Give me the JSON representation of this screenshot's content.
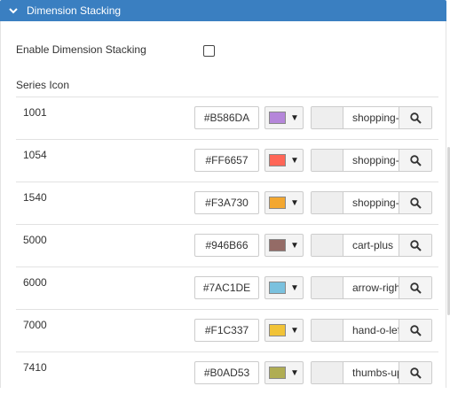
{
  "section": {
    "title": "Dimension Stacking"
  },
  "enable_label": "Enable Dimension Stacking",
  "series_icon_label": "Series Icon",
  "series": [
    {
      "name": "1001",
      "color": "#B586DA",
      "icon": "shopping-cart"
    },
    {
      "name": "1054",
      "color": "#FF6657",
      "icon": "shopping-cart"
    },
    {
      "name": "1540",
      "color": "#F3A730",
      "icon": "shopping-cart"
    },
    {
      "name": "5000",
      "color": "#946B66",
      "icon": "cart-plus"
    },
    {
      "name": "6000",
      "color": "#7AC1DE",
      "icon": "arrow-right"
    },
    {
      "name": "7000",
      "color": "#F1C337",
      "icon": "hand-o-left"
    },
    {
      "name": "7410",
      "color": "#B0AD53",
      "icon": "thumbs-up"
    }
  ],
  "icons": {
    "collapse": "chevron-down-icon",
    "search": "search-icon"
  },
  "colors": {
    "header_bg": "#3a7fc1",
    "header_text": "#ffffff"
  }
}
